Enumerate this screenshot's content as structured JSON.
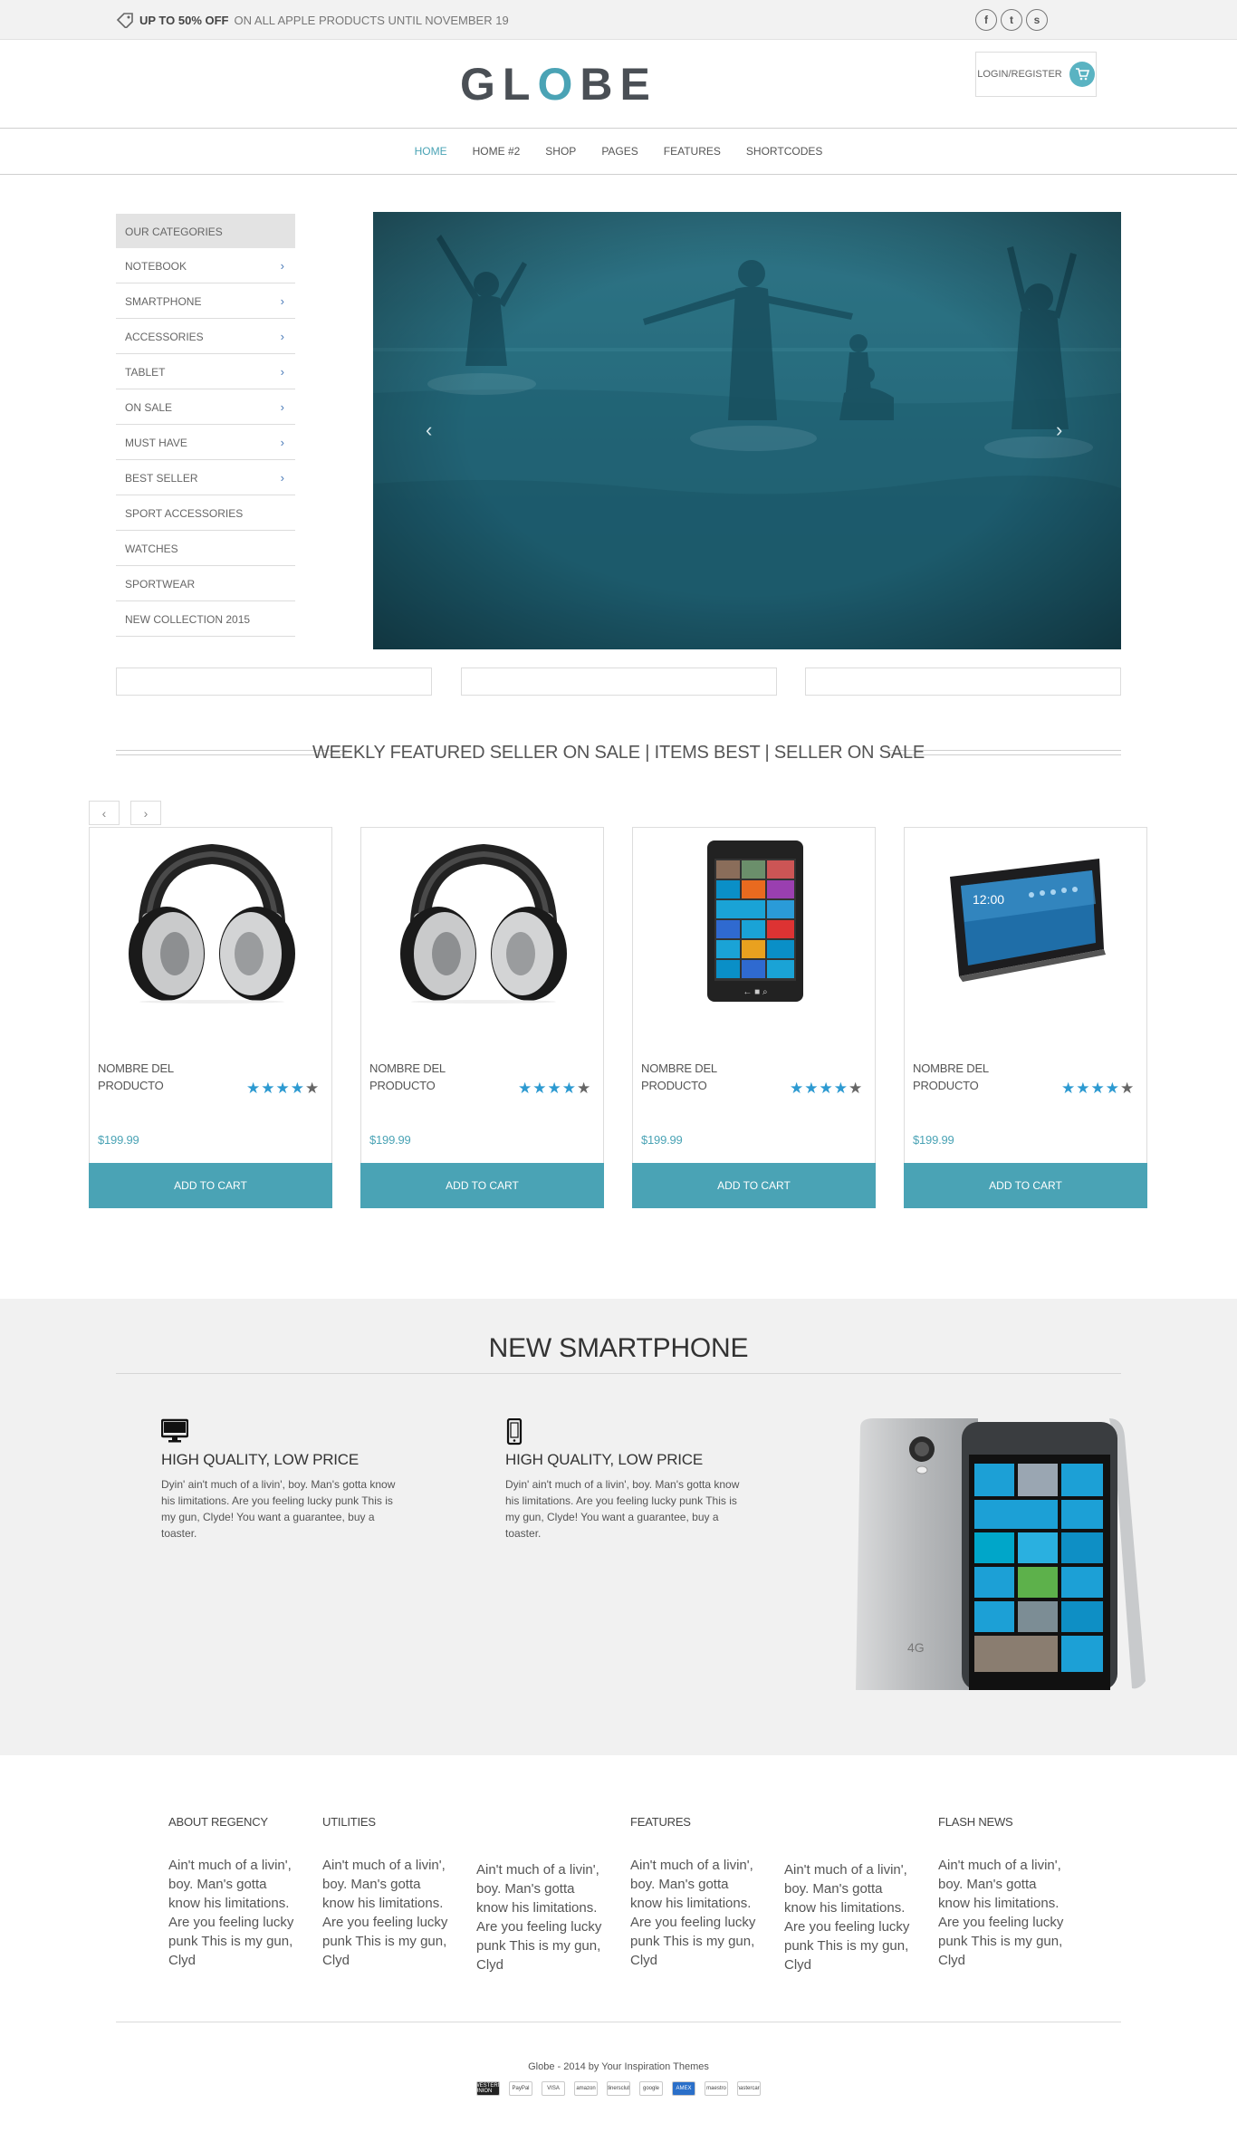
{
  "topbar": {
    "promo_bold": "UP TO 50% OFF",
    "promo_rest": "ON ALL APPLE PRODUCTS UNTIL NOVEMBER 19",
    "socials": [
      "f",
      "t",
      "s"
    ]
  },
  "header": {
    "logo_pre": "GL",
    "logo_o": "O",
    "logo_post": "BE",
    "login_label": "LOGIN/REGISTER"
  },
  "nav": {
    "items": [
      {
        "label": "HOME"
      },
      {
        "label": "HOME #2"
      },
      {
        "label": "SHOP"
      },
      {
        "label": "PAGES"
      },
      {
        "label": "FEATURES"
      },
      {
        "label": "SHORTCODES"
      }
    ]
  },
  "categories": {
    "title": "OUR CATEGORIES",
    "items": [
      {
        "label": "NOTEBOOK",
        "chevron": "›"
      },
      {
        "label": "SMARTPHONE",
        "chevron": "›"
      },
      {
        "label": "ACCESSORIES",
        "chevron": "›"
      },
      {
        "label": "TABLET",
        "chevron": "›"
      },
      {
        "label": "ON SALE",
        "chevron": "›"
      },
      {
        "label": "MUST HAVE",
        "chevron": "›"
      },
      {
        "label": "BEST SELLER",
        "chevron": "›"
      },
      {
        "label": "SPORT ACCESSORIES",
        "chevron": ""
      },
      {
        "label": "WATCHES",
        "chevron": ""
      },
      {
        "label": "SPORTWEAR",
        "chevron": ""
      },
      {
        "label": "NEW COLLECTION 2015",
        "chevron": ""
      }
    ]
  },
  "slider": {
    "prev": "‹",
    "next": "›"
  },
  "featured": {
    "title": "WEEKLY FEATURED SELLER ON SALE |  ITEMS BEST |  SELLER ON SALE",
    "prev": "‹",
    "next": "›",
    "products": [
      {
        "name_line1": "NOMBRE DEL",
        "name_line2": "PRODUCTO",
        "price": "$199.99",
        "button": "ADD TO CART",
        "rating": 4,
        "image": "headphones-icon"
      },
      {
        "name_line1": "NOMBRE DEL",
        "name_line2": "PRODUCTO",
        "price": "$199.99",
        "button": "ADD TO CART",
        "rating": 4,
        "image": "headphones-icon"
      },
      {
        "name_line1": "NOMBRE DEL",
        "name_line2": "PRODUCTO",
        "price": "$199.99",
        "button": "ADD TO CART",
        "rating": 4,
        "image": "smartphone-icon"
      },
      {
        "name_line1": "NOMBRE DEL",
        "name_line2": "PRODUCTO",
        "price": "$199.99",
        "button": "ADD TO CART",
        "rating": 4,
        "image": "tablet-icon"
      }
    ]
  },
  "smartphone_section": {
    "title": "NEW SMARTPHONE",
    "features": [
      {
        "icon": "monitor-icon",
        "heading": "HIGH QUALITY, LOW PRICE",
        "text": "Dyin' ain't much of a livin', boy. Man's gotta know his limitations. Are you feeling lucky punk This is my gun, Clyde! You want a guarantee, buy a toaster."
      },
      {
        "icon": "mobile-icon",
        "heading": "HIGH QUALITY, LOW PRICE",
        "text": "Dyin' ain't much of a livin', boy. Man's gotta know his limitations. Are you feeling lucky punk This is my gun, Clyde! You want a guarantee, buy a toaster."
      }
    ]
  },
  "footer": {
    "columns": [
      {
        "title": "ABOUT REGENCY",
        "text": "Ain't much of a livin', boy. Man's gotta know his limitations. Are you feeling lucky punk This is my gun, Clyd"
      },
      {
        "title": "UTILITIES",
        "text": "Ain't much of a livin', boy. Man's gotta know his limitations. Are you feeling lucky punk This is my gun, Clyd"
      },
      {
        "title": "",
        "text": "Ain't much of a livin', boy. Man's gotta know his limitations. Are you feeling lucky punk This is my gun, Clyd"
      },
      {
        "title": "FEATURES",
        "text": "Ain't much of a livin', boy. Man's gotta know his limitations. Are you feeling lucky punk This is my gun, Clyd"
      },
      {
        "title": "",
        "text": "Ain't much of a livin', boy. Man's gotta know his limitations. Are you feeling lucky punk This is my gun, Clyd"
      },
      {
        "title": "FLASH NEWS",
        "text": "Ain't much of a livin', boy. Man's gotta know his limitations. Are you feeling lucky punk This is my gun, Clyd"
      }
    ],
    "copyright": "Globe - 2014 by Your Inspiration Themes",
    "payments": [
      "WESTERN UNION",
      "PayPal",
      "VISA",
      "amazon",
      "dinersclub",
      "google",
      "AMEX",
      "maestro",
      "mastercard"
    ]
  },
  "colors": {
    "accent": "#4aa3b5",
    "star": "#2d9ad1",
    "section_bg": "#f1f1f1"
  }
}
